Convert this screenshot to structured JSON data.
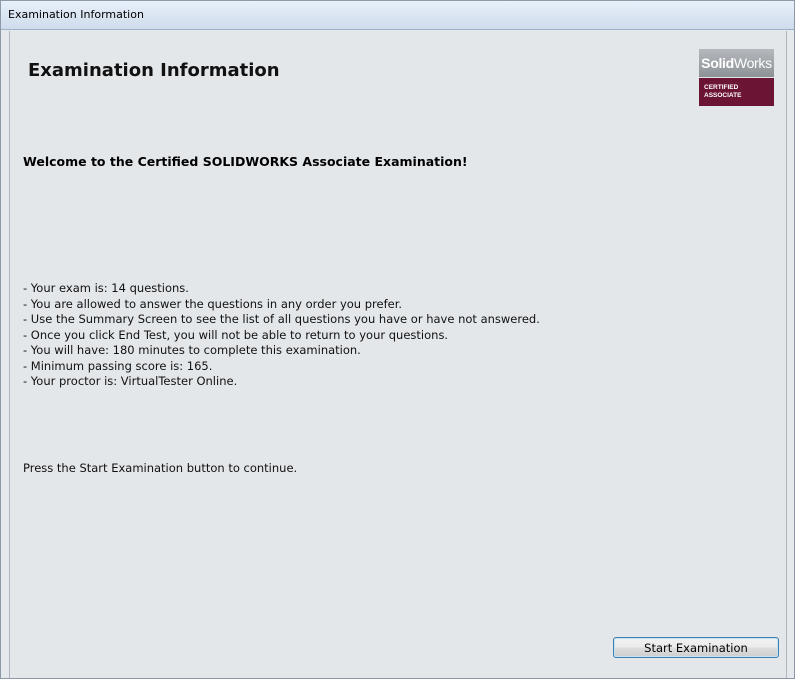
{
  "window": {
    "title": "Examination Information"
  },
  "header": {
    "title": "Examination Information"
  },
  "logo": {
    "brand_bold": "Solid",
    "brand_regular": "Works",
    "line1": "CERTIFIED",
    "line2": "ASSOCIATE",
    "colors": {
      "top": "#9ca1a6",
      "bottom": "#6b1433"
    }
  },
  "welcome": "Welcome to the Certified SOLIDWORKS Associate Examination!",
  "rules": [
    "- Your exam is: 14 questions.",
    "- You are allowed to answer the questions in any order you prefer.",
    "- Use the Summary Screen to see the list of all questions you have or have not answered.",
    "- Once you click End Test, you will not be able to return to your questions.",
    "- You will have: 180 minutes to complete this examination.",
    "- Minimum passing score is: 165.",
    "- Your proctor is: VirtualTester Online."
  ],
  "instruction": "Press the Start Examination button to continue.",
  "buttons": {
    "start_label": "Start Examination"
  }
}
